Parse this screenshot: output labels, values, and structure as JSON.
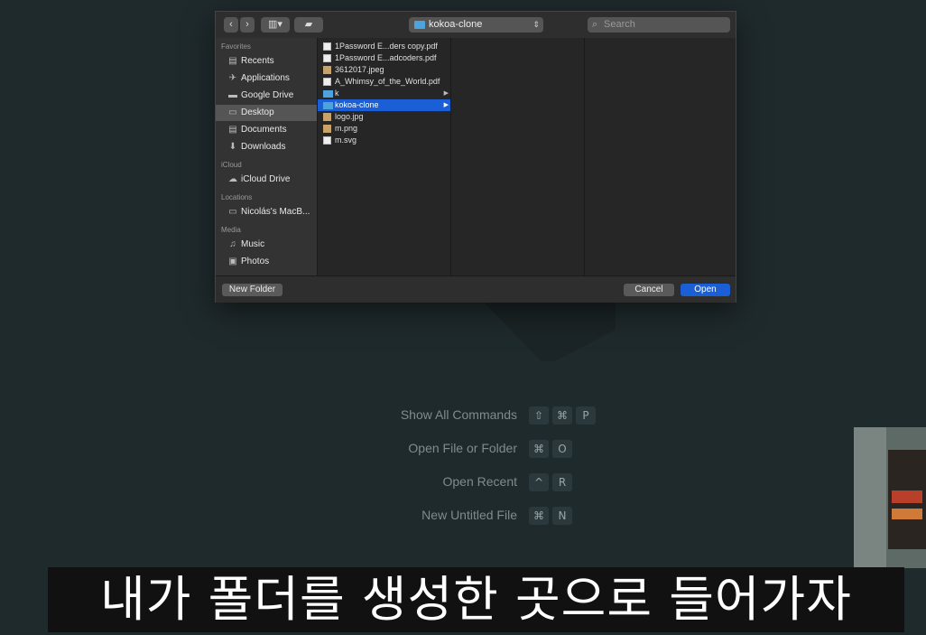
{
  "welcome": {
    "commands": [
      {
        "label": "Show All Commands",
        "keys": [
          "⇧",
          "⌘",
          "P"
        ]
      },
      {
        "label": "Open File or Folder",
        "keys": [
          "⌘",
          "O"
        ]
      },
      {
        "label": "Open Recent",
        "keys": [
          "^",
          "R"
        ]
      },
      {
        "label": "New Untitled File",
        "keys": [
          "⌘",
          "N"
        ]
      }
    ]
  },
  "dialog": {
    "toolbar": {
      "back": "‹",
      "forward": "›",
      "view": "▥▾",
      "folder_action": "▰",
      "path": "kokoa-clone",
      "search_placeholder": "Search"
    },
    "sidebar": {
      "sections": [
        {
          "heading": "Favorites",
          "items": [
            {
              "label": "Recents",
              "icon": "recents-icon",
              "glyph": "▤"
            },
            {
              "label": "Applications",
              "icon": "applications-icon",
              "glyph": "✈"
            },
            {
              "label": "Google Drive",
              "icon": "folder-icon",
              "glyph": "▬"
            },
            {
              "label": "Desktop",
              "icon": "desktop-icon",
              "glyph": "▭",
              "selected": true
            },
            {
              "label": "Documents",
              "icon": "documents-icon",
              "glyph": "▤"
            },
            {
              "label": "Downloads",
              "icon": "downloads-icon",
              "glyph": "⬇"
            }
          ]
        },
        {
          "heading": "iCloud",
          "items": [
            {
              "label": "iCloud Drive",
              "icon": "cloud-icon",
              "glyph": "☁"
            }
          ]
        },
        {
          "heading": "Locations",
          "items": [
            {
              "label": "Nicolás's MacB...",
              "icon": "laptop-icon",
              "glyph": "▭"
            }
          ]
        },
        {
          "heading": "Media",
          "items": [
            {
              "label": "Music",
              "icon": "music-icon",
              "glyph": "♫"
            },
            {
              "label": "Photos",
              "icon": "camera-icon",
              "glyph": "▣"
            }
          ]
        }
      ]
    },
    "files": [
      {
        "name": "1Password E...ders copy.pdf",
        "type": "doc"
      },
      {
        "name": "1Password E...adcoders.pdf",
        "type": "doc"
      },
      {
        "name": "3612017.jpeg",
        "type": "img"
      },
      {
        "name": "A_Whimsy_of_the_World.pdf",
        "type": "doc"
      },
      {
        "name": "k",
        "type": "folder"
      },
      {
        "name": "kokoa-clone",
        "type": "folder",
        "selected": true
      },
      {
        "name": "logo.jpg",
        "type": "img"
      },
      {
        "name": "m.png",
        "type": "img"
      },
      {
        "name": "m.svg",
        "type": "doc"
      }
    ],
    "buttons": {
      "new_folder": "New Folder",
      "cancel": "Cancel",
      "open": "Open"
    }
  },
  "subtitle": "내가 폴더를 생성한 곳으로 들어가자",
  "colors": {
    "selection": "#1a5fd6",
    "folder": "#4ca3dd",
    "background": "#1f2a2d"
  }
}
